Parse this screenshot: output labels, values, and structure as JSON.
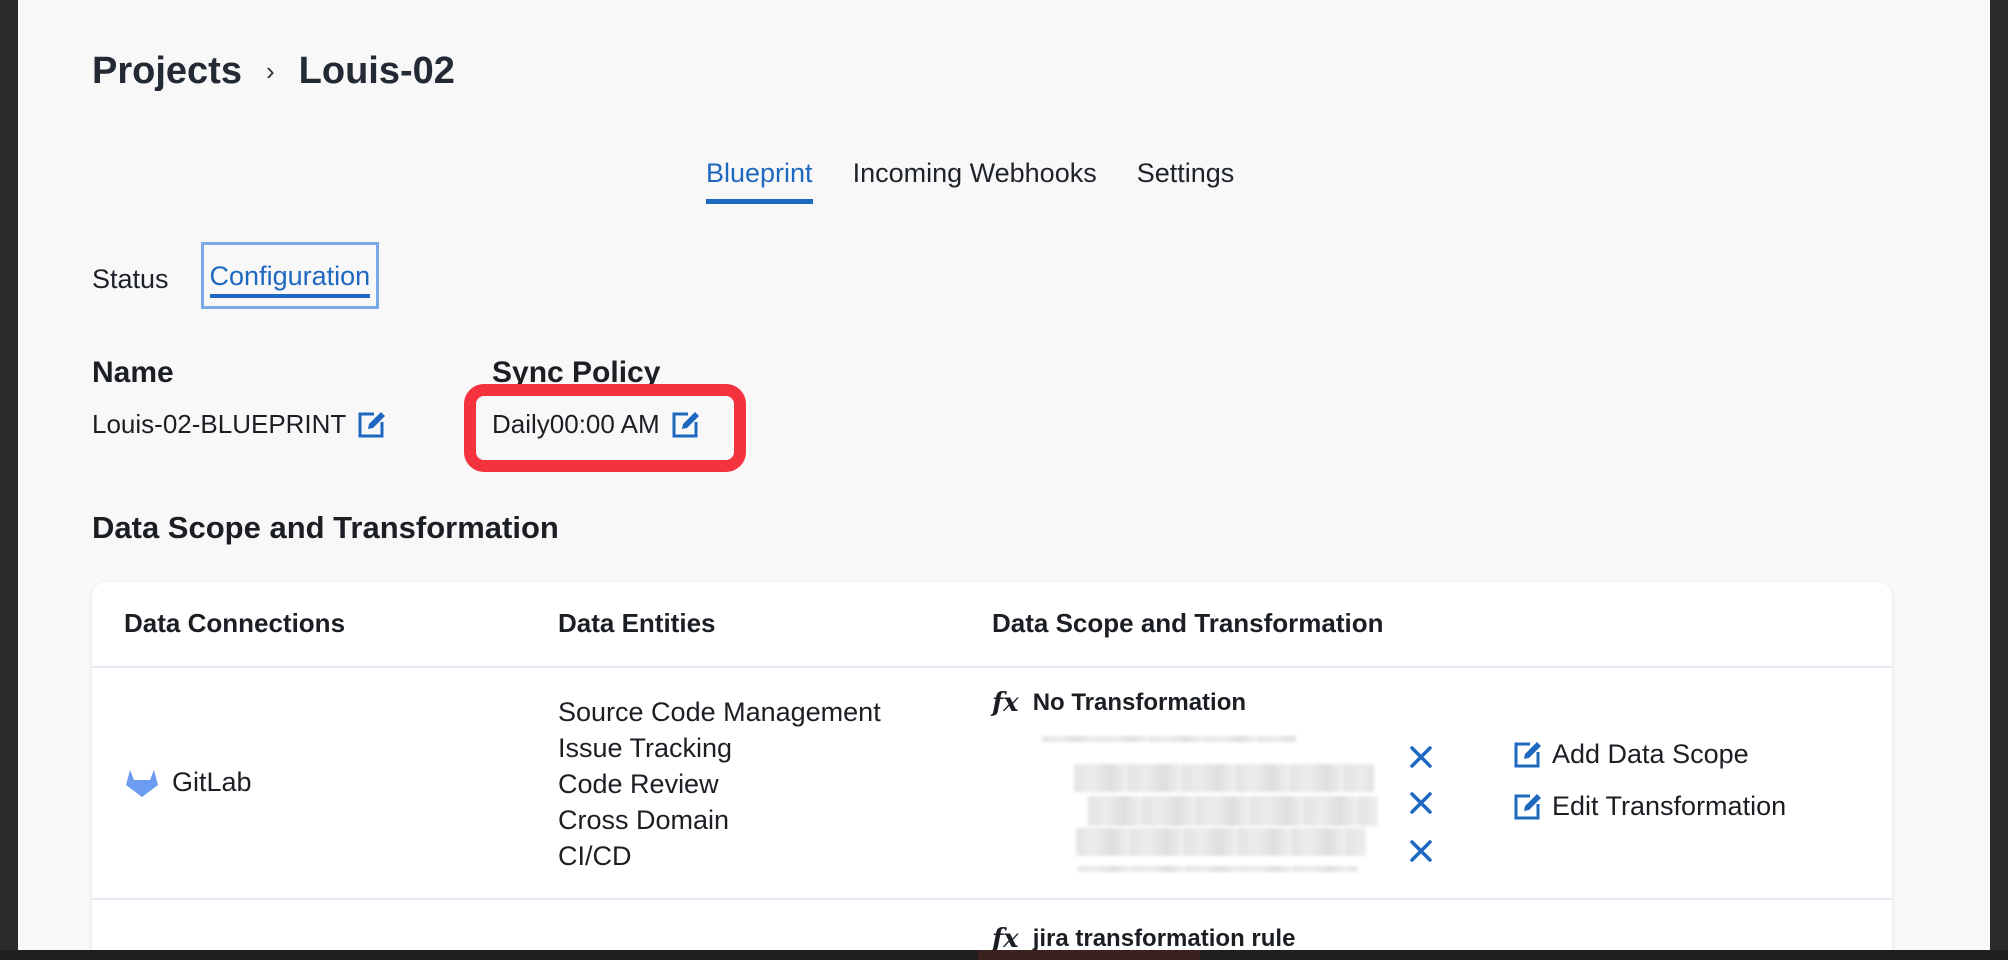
{
  "breadcrumb": {
    "root": "Projects",
    "current": "Louis-02"
  },
  "tabs": [
    {
      "label": "Blueprint",
      "active": true
    },
    {
      "label": "Incoming Webhooks",
      "active": false
    },
    {
      "label": "Settings",
      "active": false
    }
  ],
  "subtabs": [
    {
      "label": "Status",
      "active": false
    },
    {
      "label": "Configuration",
      "active": true
    }
  ],
  "name_field": {
    "label": "Name",
    "value": "Louis-02-BLUEPRINT"
  },
  "sync_policy": {
    "label": "Sync Policy",
    "value": "Daily00:00 AM"
  },
  "section_title": "Data Scope and Transformation",
  "table": {
    "headers": [
      "Data Connections",
      "Data Entities",
      "Data Scope and Transformation"
    ],
    "rows": [
      {
        "connection": "GitLab",
        "entities": [
          "Source Code Management",
          "Issue Tracking",
          "Code Review",
          "Cross Domain",
          "CI/CD"
        ],
        "transformation": "No Transformation",
        "actions": {
          "add_scope": "Add Data Scope",
          "edit_transformation": "Edit Transformation"
        }
      },
      {
        "transformation": "jira transformation rule"
      }
    ]
  },
  "colors": {
    "accent": "#1f68c0",
    "highlight": "#f5333f",
    "gitlab": "#6b9cf0"
  },
  "icons": {
    "edit": "edit-icon",
    "remove": "close-icon",
    "connection": "gitlab-icon",
    "function": "fx-icon"
  }
}
